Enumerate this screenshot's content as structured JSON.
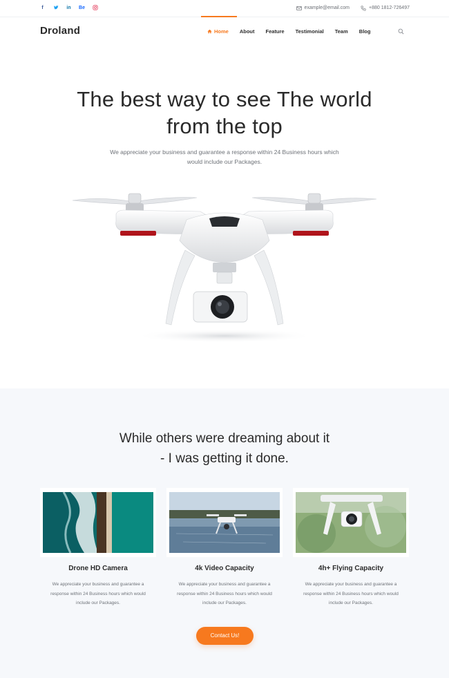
{
  "topbar": {
    "social": [
      {
        "icon": "facebook-icon",
        "glyph": "f"
      },
      {
        "icon": "twitter-icon",
        "glyph": "t"
      },
      {
        "icon": "linkedin-icon",
        "glyph": "in"
      },
      {
        "icon": "behance-icon",
        "glyph": "Be"
      },
      {
        "icon": "instagram-icon",
        "glyph": "◎"
      }
    ],
    "email": "example@email.com",
    "phone": "+880 1812-726497"
  },
  "nav": {
    "logo": "Droland",
    "items": [
      {
        "label": "Home",
        "active": true
      },
      {
        "label": "About"
      },
      {
        "label": "Feature"
      },
      {
        "label": "Testimonial"
      },
      {
        "label": "Team"
      },
      {
        "label": "Blog"
      }
    ],
    "accent": "#f7791e"
  },
  "hero": {
    "title_line1": "The best way to see The world",
    "title_line2": "from the top",
    "subtitle_line1": "We appreciate your business and guarantee a response within 24 Business hours which",
    "subtitle_line2": "would include our Packages."
  },
  "features": {
    "title_line1": "While others were dreaming about it",
    "title_line2": "- I was getting it done.",
    "cards": [
      {
        "title": "Drone HD Camera",
        "desc_line1": "We appreciate your business and guarantee a",
        "desc_line2": "response within 24 Business hours which would",
        "desc_line3": "include our Packages."
      },
      {
        "title": "4k Video Capacity",
        "desc_line1": "We appreciate your business and guarantee a",
        "desc_line2": "response within 24 Business hours which would",
        "desc_line3": "include our Packages."
      },
      {
        "title": "4h+ Flying Capacity",
        "desc_line1": "We appreciate your business and guarantee a",
        "desc_line2": "response within 24 Business hours which would",
        "desc_line3": "include our Packages."
      }
    ],
    "cta": "Contact Us!"
  }
}
